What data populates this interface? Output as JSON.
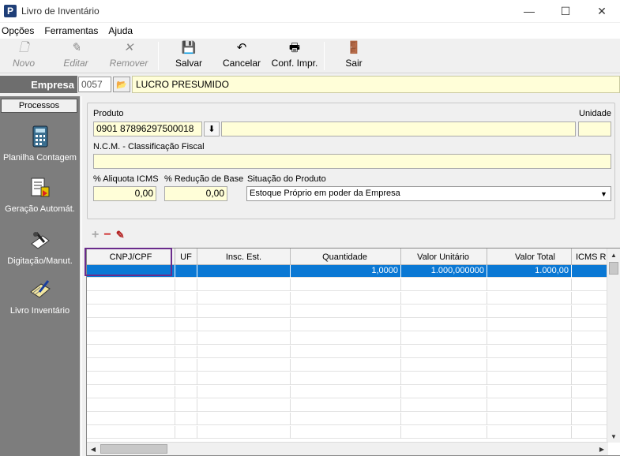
{
  "window": {
    "title": "Livro de Inventário",
    "icon_letter": "P",
    "minimize": "—",
    "maximize": "☐",
    "close": "✕"
  },
  "menu": [
    "Opções",
    "Ferramentas",
    "Ajuda"
  ],
  "toolbar": {
    "novo": "Novo",
    "editar": "Editar",
    "remover": "Remover",
    "salvar": "Salvar",
    "cancelar": "Cancelar",
    "conf_impr": "Conf. Impr.",
    "sair": "Sair"
  },
  "empresa": {
    "label": "Empresa",
    "code": "0057",
    "name": "LUCRO PRESUMIDO"
  },
  "sidebar": {
    "header": "Processos",
    "items": [
      "Planilha Contagem",
      "Geração Automát.",
      "Digitação/Manut.",
      "Livro Inventário"
    ]
  },
  "form": {
    "produto_label": "Produto",
    "produto_value": "87896297500018 0901",
    "unidade_label": "Unidade",
    "unidade_value": "",
    "ncm_label": "N.C.M. - Classificação Fiscal",
    "ncm_value": "",
    "aliquota_label": "% Aliquota ICMS",
    "aliquota_value": "0,00",
    "reducao_label": "% Redução de Base",
    "reducao_value": "0,00",
    "situacao_label": "Situação do Produto",
    "situacao_value": "Estoque Próprio em poder da Empresa"
  },
  "grid": {
    "columns": [
      "CNPJ/CPF",
      "UF",
      "Insc. Est.",
      "Quantidade",
      "Valor Unitário",
      "Valor Total",
      "ICMS Re"
    ],
    "rows": [
      {
        "cnpj": "",
        "uf": "",
        "insc": "",
        "quantidade": "1,0000",
        "valor_unitario": "1.000,000000",
        "valor_total": "1.000,00",
        "icms": ""
      }
    ]
  }
}
